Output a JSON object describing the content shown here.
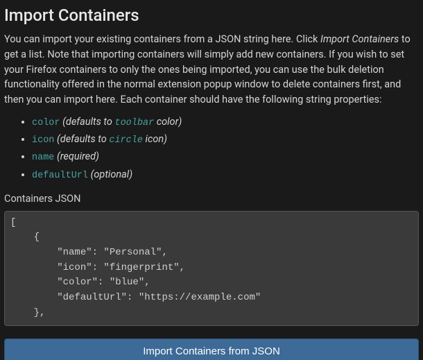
{
  "heading": "Import Containers",
  "intro": {
    "before_em": "You can import your existing containers from a JSON string here. Click ",
    "em": "Import Containers",
    "after_em": " to get a list. Note that importing containers will simply add new containers. If you wish to set your Firefox containers to only the ones being imported, you can use the bulk deletion functionality offered in the normal extension popup window to delete containers first, and then you can import here. Each container should have the following string properties:"
  },
  "props": [
    {
      "code": "color",
      "mid": " (defaults to ",
      "code2": "toolbar",
      "tail": " color)"
    },
    {
      "code": "icon",
      "mid": " (defaults to ",
      "code2": "circle",
      "tail": " icon)"
    },
    {
      "code": "name",
      "mid": " (required)",
      "code2": "",
      "tail": ""
    },
    {
      "code": "defaultUrl",
      "mid": " (optional)",
      "code2": "",
      "tail": ""
    }
  ],
  "textarea_label": "Containers JSON",
  "textarea_value": "[\n    {\n        \"name\": \"Personal\",\n        \"icon\": \"fingerprint\",\n        \"color\": \"blue\",\n        \"defaultUrl\": \"https://example.com\"\n    },",
  "button_label": "Import Containers from JSON",
  "colors": {
    "bg": "#1a1a1a",
    "text": "#d5d5d5",
    "code": "#4aa3a2",
    "textarea_bg": "#3a3a3a",
    "button_bg": "#3d6a96"
  }
}
